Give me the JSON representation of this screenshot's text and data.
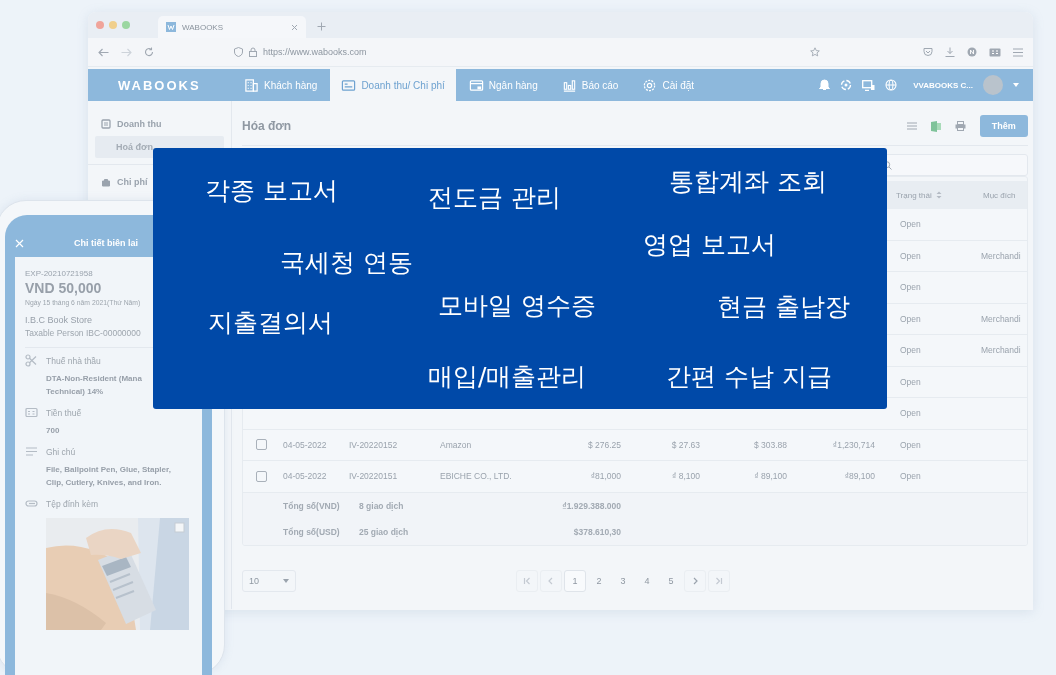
{
  "browser": {
    "tab_title": "WABOOKS",
    "url": "https://www.wabooks.com"
  },
  "nav": {
    "logo": "WABOOKS",
    "tabs": [
      {
        "label": "Khách hàng",
        "selected": false
      },
      {
        "label": "Doanh thu/ Chi phí",
        "selected": true
      },
      {
        "label": "Ngân hàng",
        "selected": false
      },
      {
        "label": "Báo cáo",
        "selected": false
      },
      {
        "label": "Cài đặt",
        "selected": false
      }
    ],
    "user": "VVABOOKS C..."
  },
  "sidebar": {
    "items": [
      {
        "label": "Doanh thu",
        "selected": false,
        "children": [
          {
            "label": "Hoá đơn",
            "selected": true
          }
        ]
      },
      {
        "label": "Chi phí",
        "selected": false
      }
    ]
  },
  "content": {
    "title": "Hóa đơn",
    "add_button": "Thêm",
    "table": {
      "columns": [
        {
          "label": "Trạng thái",
          "sortable": true
        },
        {
          "label": "Mục đích",
          "sortable": false
        }
      ],
      "rows": [
        {
          "status": "Open"
        },
        {
          "status": "Open",
          "purpose": "Merchandi"
        },
        {
          "status": "Open"
        },
        {
          "status": "Open",
          "purpose": "Merchandi"
        },
        {
          "status": "Open",
          "purpose": "Merchandi"
        },
        {
          "status": "Open"
        },
        {
          "status": "Open"
        },
        {
          "checked": false,
          "date": "04-05-2022",
          "number": "IV-20220152",
          "customer": "Amazon",
          "amount": "$ 276.25",
          "tax": "$ 27.63",
          "total": "$ 303.88",
          "total_vnd": "₫1,230,714",
          "status": "Open"
        },
        {
          "checked": false,
          "date": "04-05-2022",
          "number": "IV-20220151",
          "customer": "EBICHE CO., LTD.",
          "amount": "₫81,000",
          "tax": "₫ 8,100",
          "total": "₫ 89,100",
          "total_vnd": "₫89,100",
          "status": "Open"
        }
      ],
      "totals": [
        {
          "label": "Tổng số(VND)",
          "count": "8 giao dịch",
          "amount": "₫1.929.388.000"
        },
        {
          "label": "Tổng số(USD)",
          "count": "25 giao dịch",
          "amount": "$378.610,30"
        }
      ]
    },
    "pagination": {
      "page_size": "10",
      "pages": [
        {
          "label": "1",
          "selected": true
        },
        {
          "label": "2",
          "selected": false
        },
        {
          "label": "3",
          "selected": false
        },
        {
          "label": "4",
          "selected": false
        },
        {
          "label": "5",
          "selected": false
        }
      ]
    }
  },
  "phone": {
    "title": "Chi tiết biên lai",
    "code": "EXP-20210721958",
    "amount": "VND 50,000",
    "date": "Ngày 15 tháng 6 năm 2021(Thứ Năm)",
    "vendor": "I.B.C Book Store",
    "vendor_id": "Taxable Person IBC-00000000",
    "fields": [
      {
        "kind": "scissors",
        "label": "Thuế nhà thầu",
        "lines": [
          "DTA-Non-Resident (Mana",
          "Technical) 14%"
        ]
      },
      {
        "kind": "calculator",
        "label": "Tiền thuế",
        "lines": [
          "700"
        ]
      },
      {
        "kind": "note",
        "label": "Ghi chú",
        "lines": [
          "File, Ballpoint Pen, Glue, Stapler,",
          "Clip, Cutlery, Knives, and Iron."
        ]
      },
      {
        "kind": "attachment",
        "label": "Tệp đính kèm"
      }
    ]
  },
  "overlay": {
    "features": [
      "각종 보고서",
      "전도금 관리",
      "통합계좌 조회",
      "국세청 연동",
      "영업 보고서",
      "지출결의서",
      "모바일 영수증",
      "현금 출납장",
      "매입/매출관리",
      "간편 수납 지급"
    ]
  }
}
